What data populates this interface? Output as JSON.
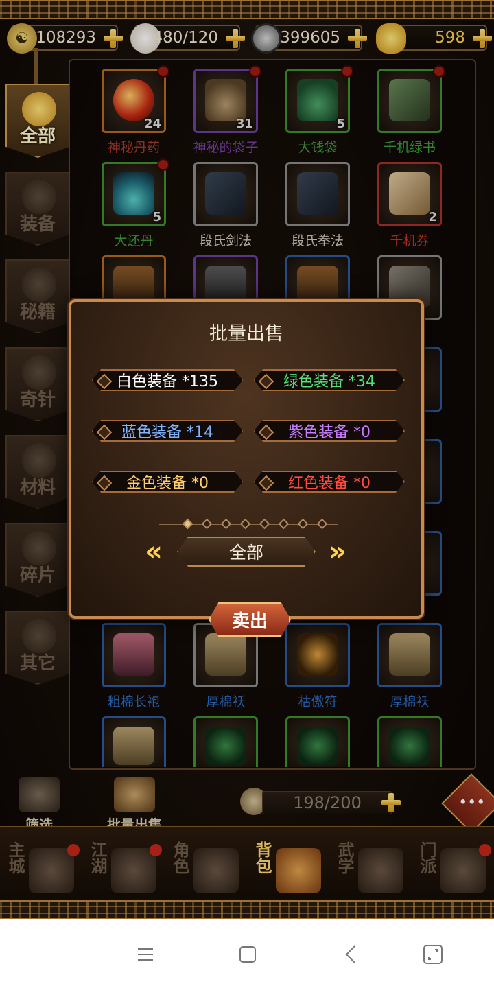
{
  "currency": [
    {
      "icon": "yinyang-icon",
      "value": "108293"
    },
    {
      "icon": "bun-stamina-icon",
      "value": "480/120"
    },
    {
      "icon": "silver-coin-icon",
      "value": "399605"
    },
    {
      "icon": "gold-ingot-icon",
      "value": "598"
    }
  ],
  "categories": [
    {
      "label": "全部",
      "active": true
    },
    {
      "label": "装备",
      "active": false
    },
    {
      "label": "秘籍",
      "active": false
    },
    {
      "label": "奇针",
      "active": false
    },
    {
      "label": "材料",
      "active": false
    },
    {
      "label": "碎片",
      "active": false
    },
    {
      "label": "其它",
      "active": false
    }
  ],
  "items": [
    {
      "name": "神秘丹药",
      "count": "24",
      "quality": "orange",
      "name_color": "#a23a2c",
      "dot": true
    },
    {
      "name": "神秘的袋子",
      "count": "31",
      "quality": "purple",
      "name_color": "#7c3fa8",
      "dot": true
    },
    {
      "name": "大钱袋",
      "count": "5",
      "quality": "green",
      "name_color": "#3f9a3a",
      "dot": true
    },
    {
      "name": "千机绿书",
      "count": "",
      "quality": "green",
      "name_color": "#3f9a3a",
      "dot": true
    },
    {
      "name": "大还丹",
      "count": "5",
      "quality": "green",
      "name_color": "#3f9a3a",
      "dot": true
    },
    {
      "name": "段氏剑法",
      "count": "",
      "quality": "white",
      "name_color": "#cfc7bb",
      "dot": false
    },
    {
      "name": "段氏拳法",
      "count": "",
      "quality": "white",
      "name_color": "#cfc7bb",
      "dot": false
    },
    {
      "name": "千机券",
      "count": "2",
      "quality": "red",
      "name_color": "#c8301f",
      "dot": false
    },
    {
      "name": "粗棉长袍",
      "count": "",
      "quality": "blue",
      "name_color": "#2c6ac0",
      "dot": false
    },
    {
      "name": "厚棉袄",
      "count": "",
      "quality": "white",
      "name_color": "#2c6ac0",
      "dot": false
    },
    {
      "name": "枯傲符",
      "count": "",
      "quality": "blue",
      "name_color": "#2c6ac0",
      "dot": false
    },
    {
      "name": "厚棉袄",
      "count": "",
      "quality": "blue",
      "name_color": "#2c6ac0",
      "dot": false
    }
  ],
  "toolbar": {
    "filter_label": "筛选",
    "batch_sell_label": "批量出售",
    "bag_capacity": "198/200"
  },
  "bottom_nav": [
    {
      "label": "主城",
      "active": false,
      "dot": true
    },
    {
      "label": "江湖",
      "active": false,
      "dot": true
    },
    {
      "label": "角色",
      "active": false,
      "dot": false
    },
    {
      "label": "背包",
      "active": true,
      "dot": false
    },
    {
      "label": "武学",
      "active": false,
      "dot": false
    },
    {
      "label": "门派",
      "active": false,
      "dot": true
    }
  ],
  "modal": {
    "title": "批量出售",
    "options": [
      {
        "label": "白色装备 *135",
        "color": "#ffffff"
      },
      {
        "label": "绿色装备 *34",
        "color": "#55e07a"
      },
      {
        "label": "蓝色装备 *14",
        "color": "#7fb4ff"
      },
      {
        "label": "紫色装备 *0",
        "color": "#c67cff"
      },
      {
        "label": "金色装备 *0",
        "color": "#ffcf6a"
      },
      {
        "label": "红色装备 *0",
        "color": "#ff4d3d"
      }
    ],
    "selector_value": "全部",
    "sell_label": "卖出",
    "page_count": 9,
    "page_active": 1
  },
  "chat_icon": "speech-bubble-icon"
}
